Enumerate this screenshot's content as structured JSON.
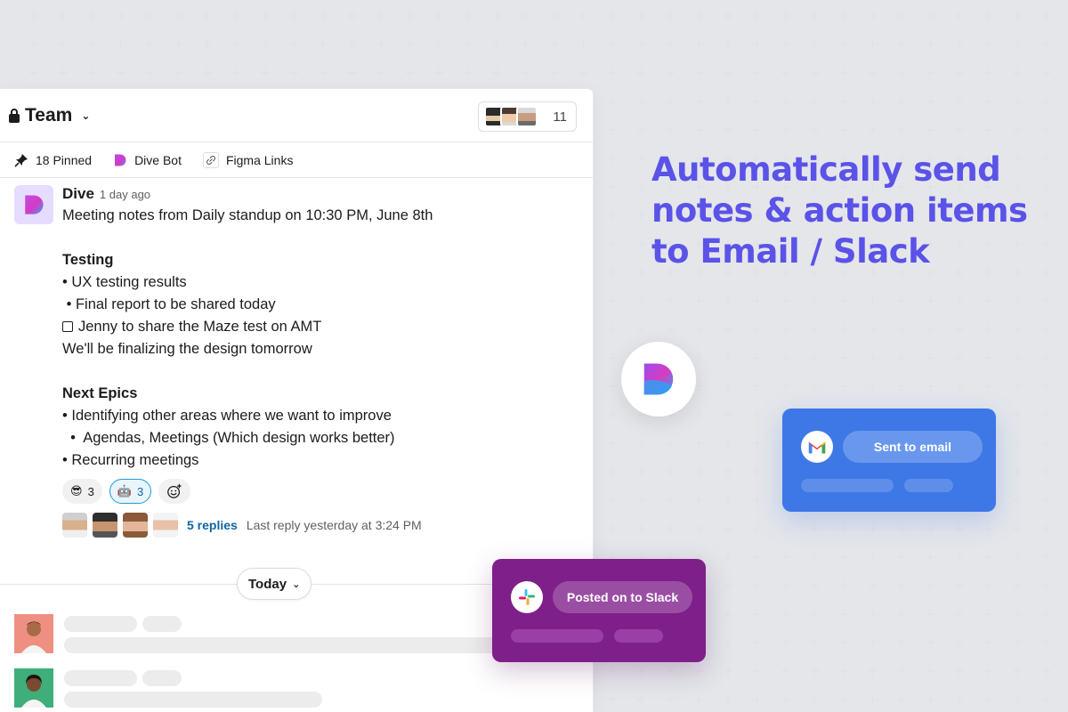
{
  "channel": {
    "name": "Team",
    "member_count": "11"
  },
  "bookmarks": [
    {
      "label": "18 Pinned",
      "icon": "pin-icon"
    },
    {
      "label": "Dive Bot",
      "icon": "dive-logo-icon"
    },
    {
      "label": "Figma Links",
      "icon": "link-icon"
    }
  ],
  "message": {
    "author": "Dive",
    "time": "1 day ago",
    "lines": [
      "Meeting notes from Daily standup on 10:30 PM, June 8th",
      "Testing",
      "• UX testing results",
      " • Final report to be shared today",
      "Jenny to share the Maze test on AMT",
      "We'll be finalizing the design tomorrow",
      "Next Epics",
      "• Identifying other areas where we want to improve",
      "  •  Agendas, Meetings (Which design works better)",
      "• Recurring meetings"
    ],
    "reactions": [
      {
        "emoji": "😎",
        "count": "3"
      },
      {
        "emoji": "🤖",
        "count": "3"
      }
    ],
    "replies_label": "5 replies",
    "last_reply": "Last reply yesterday at 3:24 PM"
  },
  "date_divider": "Today",
  "headline": "Automatically send notes & action items to Email / Slack",
  "email_card": {
    "button": "Sent to email"
  },
  "slack_card": {
    "button": "Posted on to Slack"
  },
  "colors": {
    "headline": "#5b52e8",
    "email_card": "#3d78e6",
    "slack_card": "#7f1f8a",
    "link": "#1264a3"
  }
}
